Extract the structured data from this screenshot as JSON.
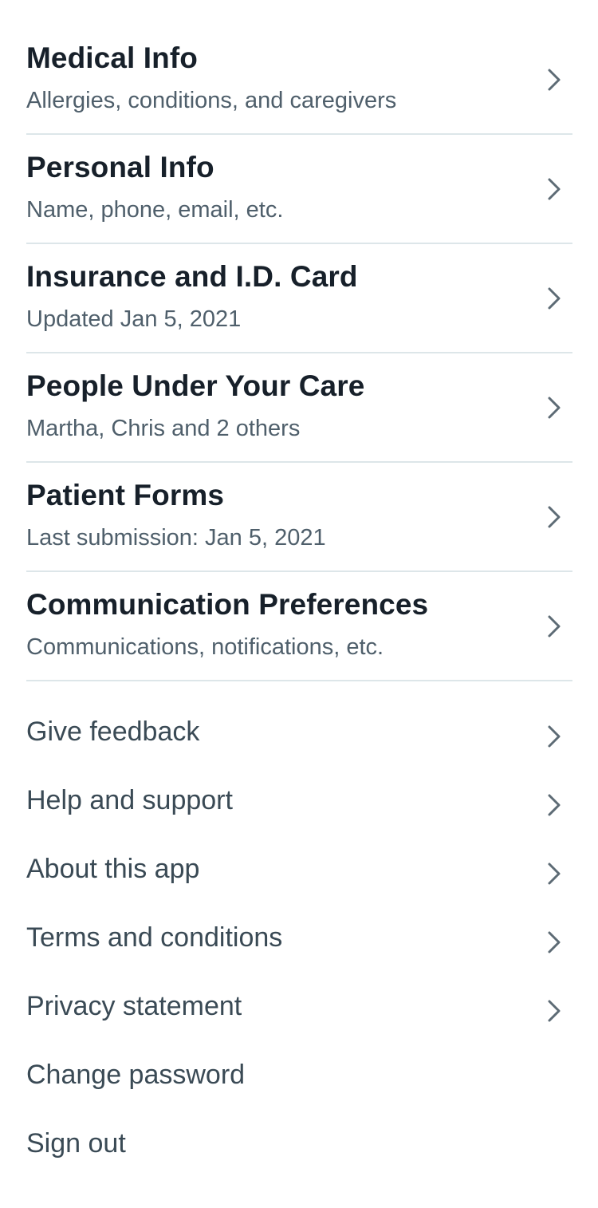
{
  "sections": [
    {
      "title": "Medical Info",
      "subtitle": "Allergies, conditions, and caregivers"
    },
    {
      "title": "Personal Info",
      "subtitle": "Name, phone, email, etc."
    },
    {
      "title": "Insurance and I.D. Card",
      "subtitle": "Updated Jan 5, 2021"
    },
    {
      "title": "People Under Your Care",
      "subtitle": "Martha, Chris and 2 others"
    },
    {
      "title": "Patient Forms",
      "subtitle": "Last submission: Jan 5, 2021"
    },
    {
      "title": "Communication Preferences",
      "subtitle": "Communications, notifications, etc."
    }
  ],
  "links": [
    {
      "label": "Give feedback",
      "icon": "chevron-right-icon"
    },
    {
      "label": "Help and support",
      "icon": "chevron-right-icon"
    },
    {
      "label": "About this app",
      "icon": "chevron-right-icon"
    },
    {
      "label": "Terms and conditions",
      "icon": "chevron-right-icon"
    },
    {
      "label": "Privacy statement",
      "icon": "chevron-right-icon"
    },
    {
      "label": "Change password",
      "icon": ""
    },
    {
      "label": "Sign out",
      "icon": ""
    }
  ],
  "colors": {
    "title": "#17202a",
    "subtitle": "#4f5f6b",
    "link": "#3a4a55",
    "divider": "#dde6e9",
    "chevron": "#5d6b75"
  }
}
